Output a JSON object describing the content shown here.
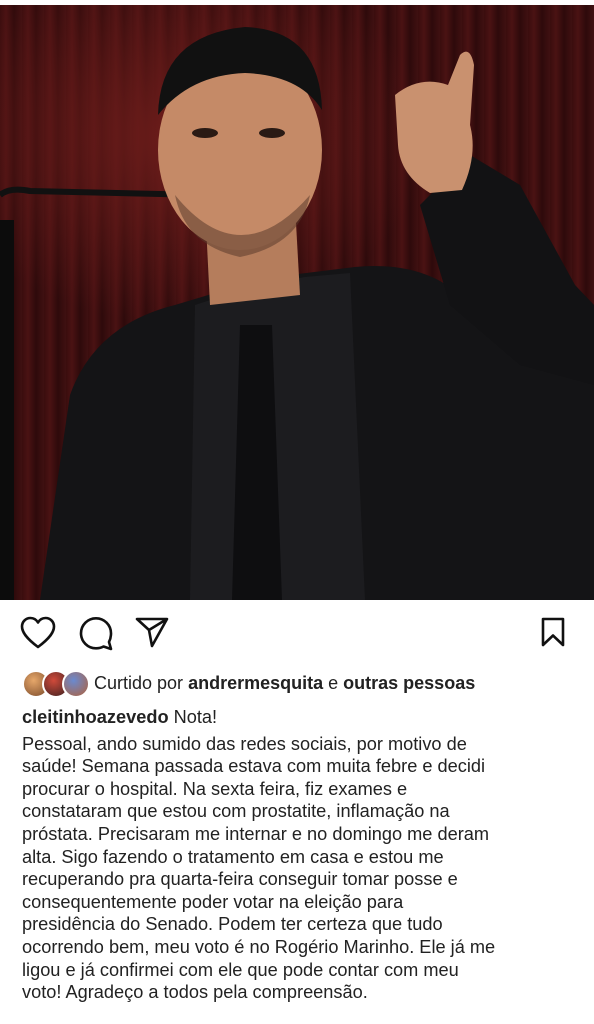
{
  "post": {
    "image_alt": "Homem de terno escuro falando ao microfone",
    "actions": {
      "like": "heart-icon",
      "comment": "comment-icon",
      "share": "send-icon",
      "save": "bookmark-icon"
    },
    "likes": {
      "prefix": "Curtido por",
      "user": "andrermesquita",
      "connector": "e",
      "others": "outras pessoas"
    },
    "caption": {
      "username": "cleitinhoazevedo",
      "title": "Nota!",
      "lines": [
        "Pessoal, ando sumido das redes sociais, por motivo de",
        "saúde! Semana passada estava com muita febre e decidi",
        "procurar o hospital. Na sexta feira, fiz exames e",
        "constataram que estou com prostatite, inflamação na",
        "próstata. Precisaram me internar e no domingo me deram",
        "alta. Sigo fazendo o tratamento em casa e estou me",
        "recuperando pra quarta-feira conseguir tomar posse e",
        "consequentemente poder votar na eleição para",
        "presidência do Senado. Podem ter certeza que tudo",
        "ocorrendo bem, meu voto é no Rogério Marinho. Ele já me",
        "ligou e já confirmei com ele que pode contar com meu",
        "voto! Agradeço a todos pela compreensão."
      ]
    },
    "colors": {
      "background": "#ffffff",
      "text": "#222222",
      "photo_backdrop": "#3a0d0e"
    }
  }
}
